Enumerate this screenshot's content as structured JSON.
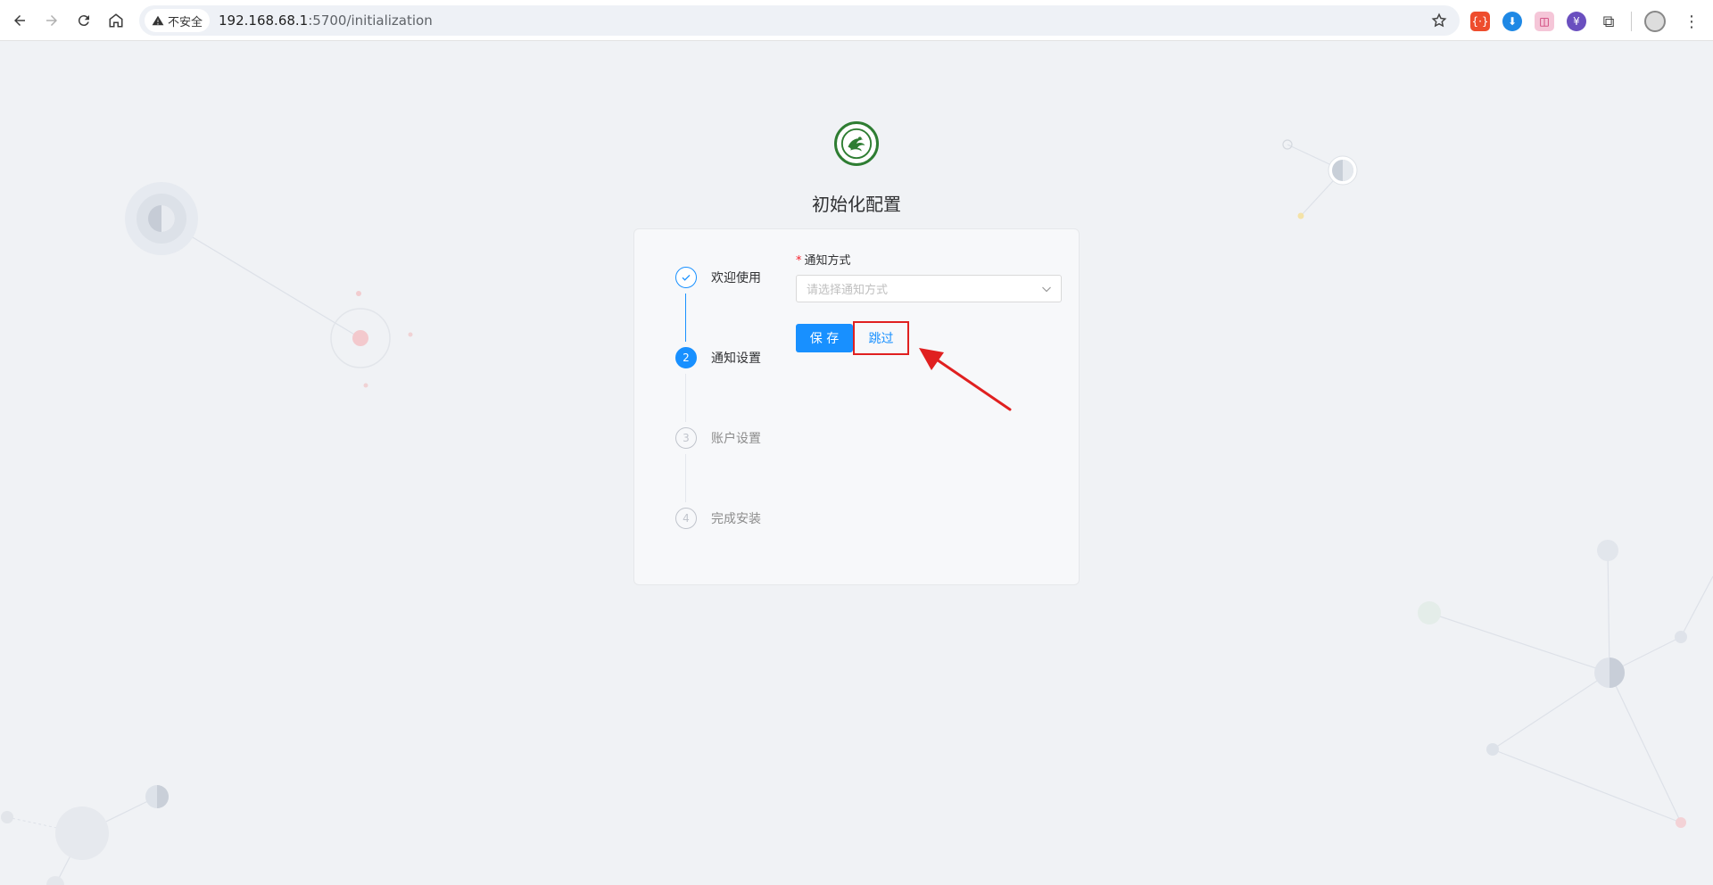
{
  "browser": {
    "security_label": "不安全",
    "url_host": "192.168.68.1",
    "url_rest": ":5700/initialization",
    "extensions": [
      {
        "name": "devtools-extension-icon",
        "glyph": "{·}"
      },
      {
        "name": "download-extension-icon",
        "glyph": "⬇"
      },
      {
        "name": "bilibili-extension-icon",
        "glyph": "◫"
      },
      {
        "name": "purple-extension-icon",
        "glyph": "¥"
      }
    ]
  },
  "page": {
    "title": "初始化配置"
  },
  "steps": [
    {
      "number": "",
      "label": "欢迎使用",
      "status": "done"
    },
    {
      "number": "2",
      "label": "通知设置",
      "status": "active"
    },
    {
      "number": "3",
      "label": "账户设置",
      "status": "wait"
    },
    {
      "number": "4",
      "label": "完成安装",
      "status": "wait"
    }
  ],
  "form": {
    "notify_label": "通知方式",
    "required_mark": "*",
    "notify_placeholder": "请选择通知方式",
    "save_label": "保 存",
    "skip_label": "跳过"
  },
  "colors": {
    "primary": "#1890ff",
    "annotation": "#e02020",
    "logo": "#2e7d32"
  }
}
